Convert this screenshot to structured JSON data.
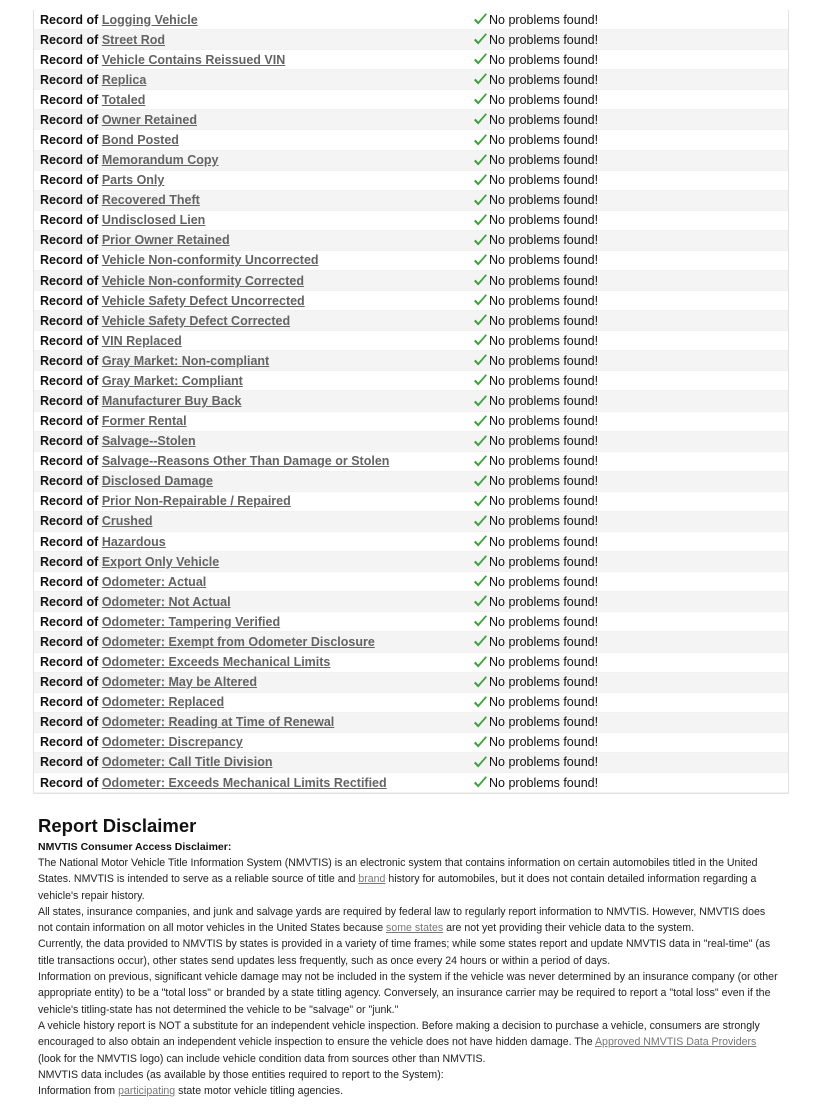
{
  "records": {
    "prefix": "Record of",
    "status_text": "No problems found!",
    "status_icon": "checkmark-icon",
    "status_color": "#3fa13b",
    "items": [
      "Logging Vehicle",
      "Street Rod",
      "Vehicle Contains Reissued VIN",
      "Replica",
      "Totaled",
      "Owner Retained",
      "Bond Posted",
      "Memorandum Copy",
      "Parts Only",
      "Recovered Theft",
      "Undisclosed Lien",
      "Prior Owner Retained",
      "Vehicle Non-conformity Uncorrected",
      "Vehicle Non-conformity Corrected",
      "Vehicle Safety Defect Uncorrected",
      "Vehicle Safety Defect Corrected",
      "VIN Replaced",
      "Gray Market: Non-compliant",
      "Gray Market: Compliant",
      "Manufacturer Buy Back",
      "Former Rental",
      "Salvage--Stolen",
      "Salvage--Reasons Other Than Damage or Stolen",
      "Disclosed Damage",
      "Prior Non-Repairable / Repaired",
      "Crushed",
      "Hazardous",
      "Export Only Vehicle",
      "Odometer: Actual",
      "Odometer: Not Actual",
      "Odometer: Tampering Verified",
      "Odometer: Exempt from Odometer Disclosure",
      "Odometer: Exceeds Mechanical Limits",
      "Odometer: May be Altered",
      "Odometer: Replaced",
      "Odometer: Reading at Time of Renewal",
      "Odometer: Discrepancy",
      "Odometer: Call Title Division",
      "Odometer: Exceeds Mechanical Limits Rectified"
    ]
  },
  "disclaimer": {
    "title": "Report Disclaimer",
    "subtitle": "NMVTIS Consumer Access Disclaimer:",
    "p1_a": "The National Motor Vehicle Title Information System (NMVTIS) is an electronic system that contains information on certain automobiles titled in the United States. NMVTIS is intended to serve as a reliable source of title and ",
    "p1_link": "brand",
    "p1_b": " history for automobiles, but it does not contain detailed information regarding a vehicle's repair history.",
    "p2_a": "All states, insurance companies, and junk and salvage yards are required by federal law to regularly report information to NMVTIS. However, NMVTIS does not contain information on all motor vehicles in the United States because ",
    "p2_link": "some states",
    "p2_b": " are not yet providing their vehicle data to the system.",
    "p3": "Currently, the data provided to NMVTIS by states is provided in a variety of time frames; while some states report and update NMVTIS data in \"real-time\" (as title transactions occur), other states send updates less frequently, such as once every 24 hours or within a period of days.",
    "p4": "Information on previous, significant vehicle damage may not be included in the system if the vehicle was never determined by an insurance company (or other appropriate entity) to be a \"total loss\" or branded by a state titling agency. Conversely, an insurance carrier may be required to report a \"total loss\" even if the vehicle's titling-state has not determined the vehicle to be \"salvage\" or \"junk.\"",
    "p5_a": "A vehicle history report is NOT a substitute for an independent vehicle inspection. Before making a decision to purchase a vehicle, consumers are strongly encouraged to also obtain an independent vehicle inspection to ensure the vehicle does not have hidden damage. The ",
    "p5_link": "Approved NMVTIS Data Providers",
    "p5_b": " (look for the NMVTIS logo) can include vehicle condition data from sources other than NMVTIS.",
    "p6": "NMVTIS data includes (as available by those entities required to report to the System):",
    "p7_a": "Information from ",
    "p7_link": "participating",
    "p7_b": " state motor vehicle titling agencies."
  }
}
